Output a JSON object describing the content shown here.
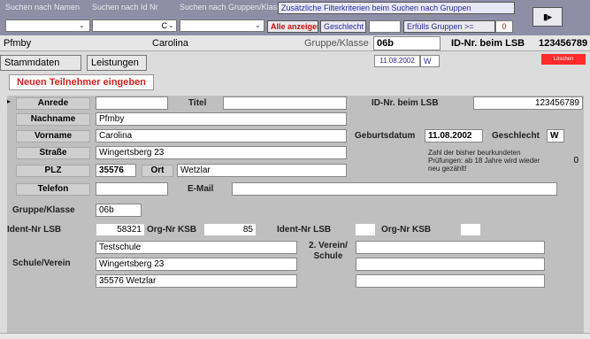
{
  "toolbar": {
    "search_name_label": "Suchen nach Namen",
    "search_nr_label": "Suchen nach Id Nr",
    "search_group_label": "Suchen nach Gruppen/Klassen",
    "extra_filter_label": "Zusätzliche Filterkriterien beim Suchen nach Gruppen",
    "nr_value": "C",
    "show_all_button": "Alle anzeigen",
    "gender_label": "Geschlecht",
    "fulfilled_label": "Erfülls Gruppen >=",
    "fulfilled_value": "0"
  },
  "header": {
    "last_name": "Pfmby",
    "first_name": "Carolina",
    "group_label": "Gruppe/Klasse",
    "group_value": "06b",
    "id_label": "ID-Nr. beim LSB",
    "id_value": "123456789",
    "birthdate": "11.08.2002",
    "gender": "W",
    "red_button": "Löschen"
  },
  "tabs": [
    {
      "label": "Stammdaten"
    },
    {
      "label": "Leistungen"
    }
  ],
  "new_button": "Neuen Teilnehmer eingeben",
  "form": {
    "anrede_label": "Anrede",
    "titel_label": "Titel",
    "id_lsb_label": "ID-Nr. beim LSB",
    "id_lsb_value": "123456789",
    "nachname_label": "Nachname",
    "nachname_value": "Pfmby",
    "vorname_label": "Vorname",
    "vorname_value": "Carolina",
    "geburtsdatum_label": "Geburtsdatum",
    "geburtsdatum_value": "11.08.2002",
    "geschlecht_label": "Geschlecht",
    "geschlecht_value": "W",
    "strasse_label": "Straße",
    "strasse_value": "Wingertsberg 23",
    "plz_label": "PLZ",
    "plz_value": "35576",
    "ort_label": "Ort",
    "ort_value": "Wetzlar",
    "pruefungen_note": "Zahl der bisher beurkundeten Prüfungen: ab 18 Jahre wird wieder neu gezählt!",
    "pruefungen_value": "0",
    "telefon_label": "Telefon",
    "email_label": "E-Mail",
    "gruppe_label": "Gruppe/Klasse",
    "gruppe_value": "06b",
    "ident_lsb_label": "Ident-Nr LSB",
    "ident_lsb_value": "58321",
    "org_ksb_label": "Org-Nr KSB",
    "org_ksb_value": "85",
    "ident_lsb2_label": "Ident-Nr LSB",
    "org_ksb2_label": "Org-Nr KSB",
    "schule_label": "Schule/Verein",
    "schule_line1": "Testschule",
    "schule_line2": "Wingertsberg 23",
    "schule_line3": "35576 Wetzlar",
    "verein2_label": "2. Verein/ Schule"
  }
}
